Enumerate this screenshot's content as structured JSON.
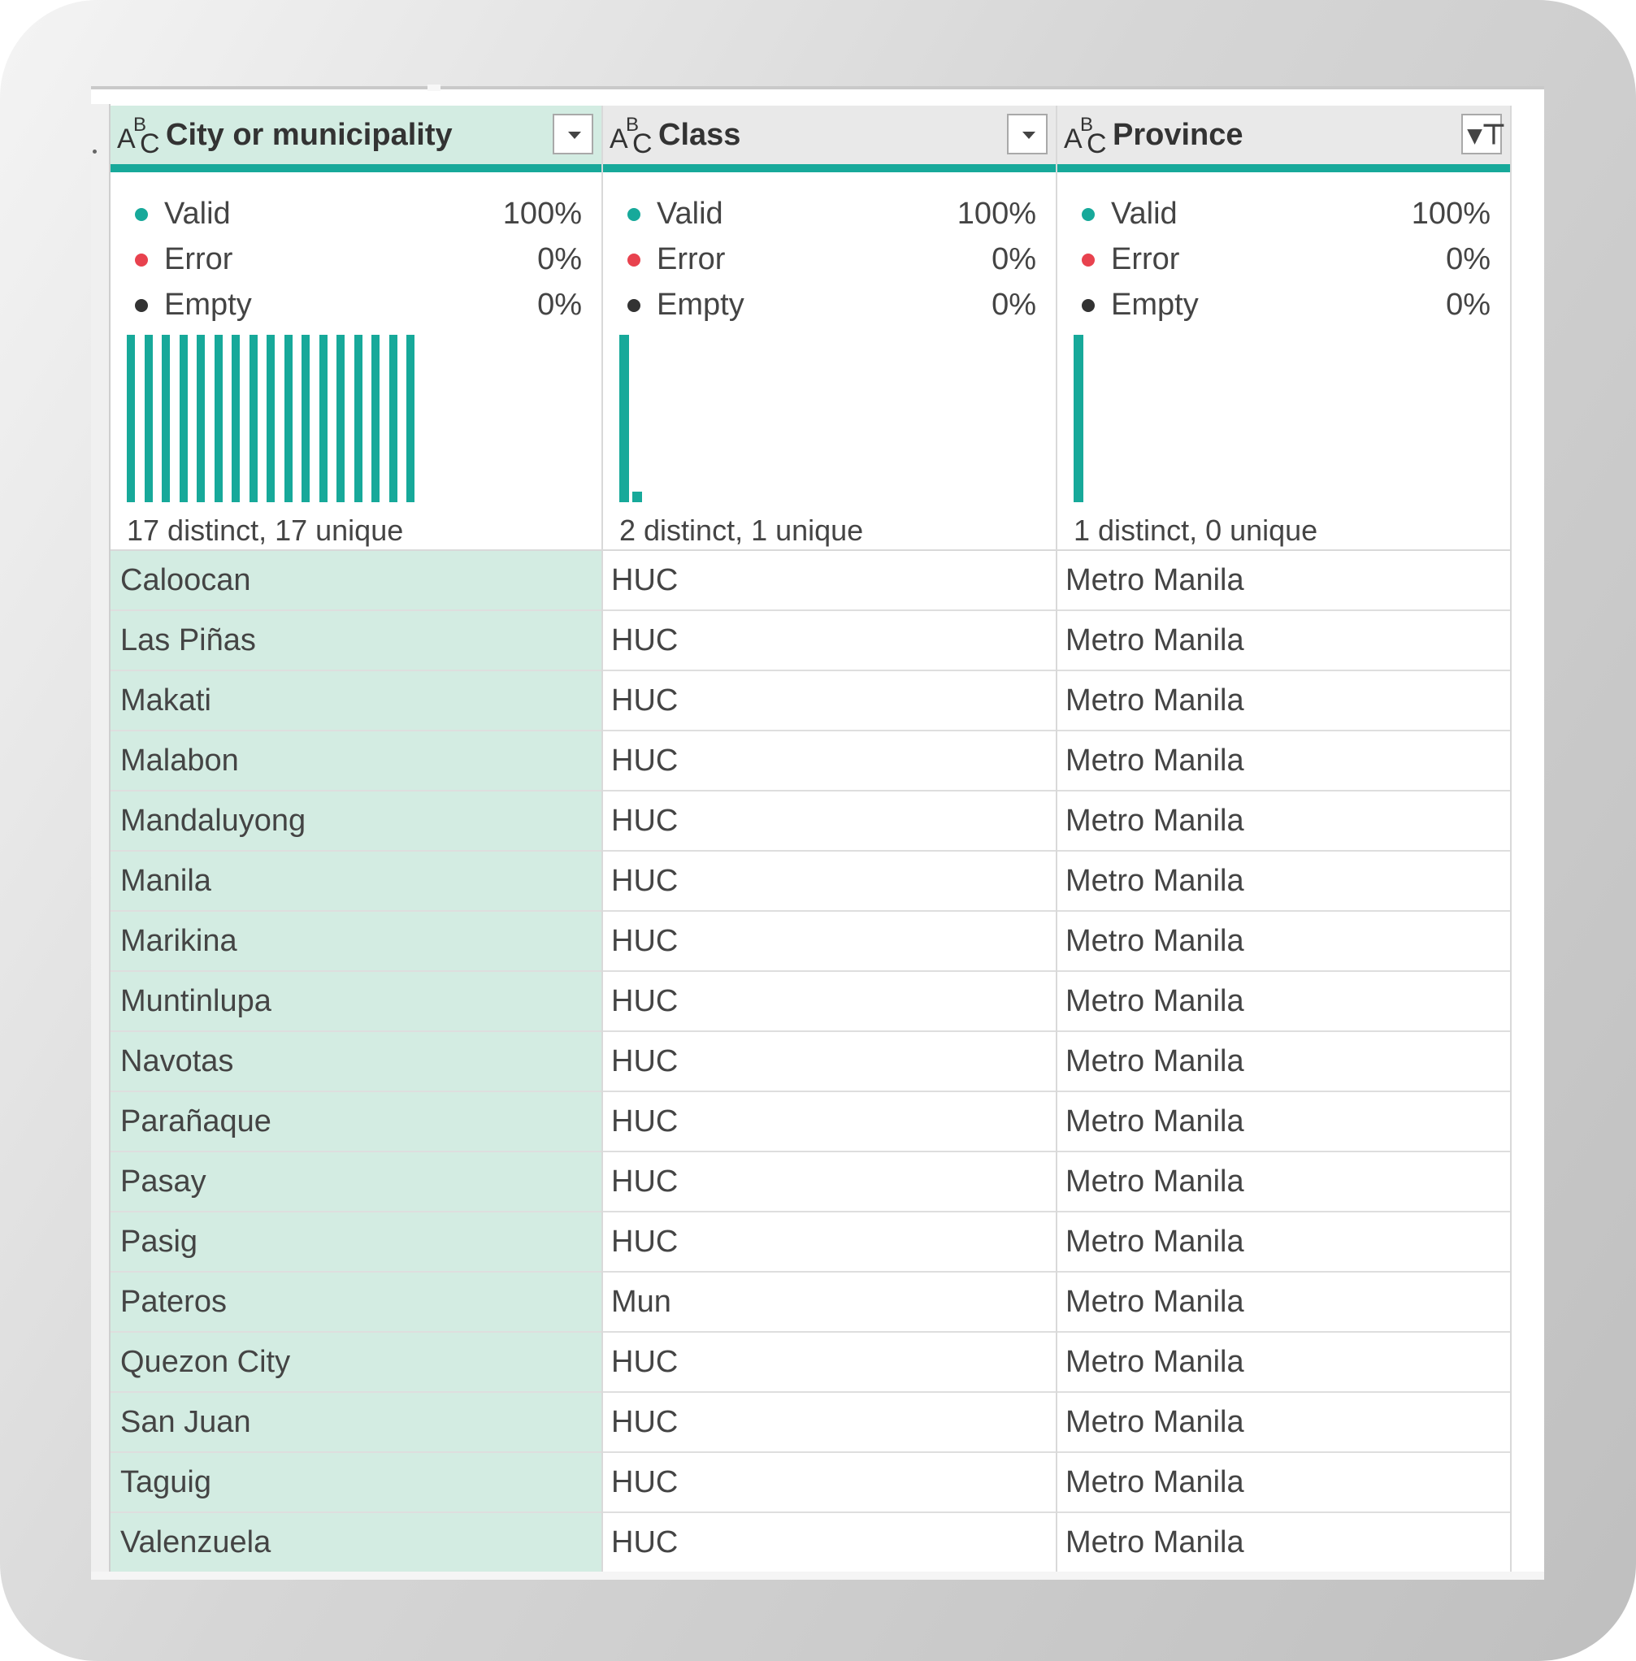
{
  "columns": [
    {
      "title": "City or municipality",
      "type_icon": "abc-text-icon",
      "header_button": "dropdown",
      "stats": {
        "valid": "Valid",
        "valid_pct": "100%",
        "error": "Error",
        "error_pct": "0%",
        "empty": "Empty",
        "empty_pct": "0%"
      },
      "distribution": [
        1,
        1,
        1,
        1,
        1,
        1,
        1,
        1,
        1,
        1,
        1,
        1,
        1,
        1,
        1,
        1,
        1
      ],
      "distinct_text": "17 distinct, 17 unique"
    },
    {
      "title": "Class",
      "type_icon": "abc-text-icon",
      "header_button": "dropdown",
      "stats": {
        "valid": "Valid",
        "valid_pct": "100%",
        "error": "Error",
        "error_pct": "0%",
        "empty": "Empty",
        "empty_pct": "0%"
      },
      "distribution": [
        16,
        1
      ],
      "distinct_text": "2 distinct, 1 unique"
    },
    {
      "title": "Province",
      "type_icon": "abc-text-icon",
      "header_button": "filter-active",
      "stats": {
        "valid": "Valid",
        "valid_pct": "100%",
        "error": "Error",
        "error_pct": "0%",
        "empty": "Empty",
        "empty_pct": "0%"
      },
      "distribution": [
        17
      ],
      "distinct_text": "1 distinct, 0 unique"
    }
  ],
  "rows": [
    [
      "Caloocan",
      "HUC",
      "Metro Manila"
    ],
    [
      "Las Piñas",
      "HUC",
      "Metro Manila"
    ],
    [
      "Makati",
      "HUC",
      "Metro Manila"
    ],
    [
      "Malabon",
      "HUC",
      "Metro Manila"
    ],
    [
      "Mandaluyong",
      "HUC",
      "Metro Manila"
    ],
    [
      "Manila",
      "HUC",
      "Metro Manila"
    ],
    [
      "Marikina",
      "HUC",
      "Metro Manila"
    ],
    [
      "Muntinlupa",
      "HUC",
      "Metro Manila"
    ],
    [
      "Navotas",
      "HUC",
      "Metro Manila"
    ],
    [
      "Parañaque",
      "HUC",
      "Metro Manila"
    ],
    [
      "Pasay",
      "HUC",
      "Metro Manila"
    ],
    [
      "Pasig",
      "HUC",
      "Metro Manila"
    ],
    [
      "Pateros",
      "Mun",
      "Metro Manila"
    ],
    [
      "Quezon City",
      "HUC",
      "Metro Manila"
    ],
    [
      "San Juan",
      "HUC",
      "Metro Manila"
    ],
    [
      "Taguig",
      "HUC",
      "Metro Manila"
    ],
    [
      "Valenzuela",
      "HUC",
      "Metro Manila"
    ]
  ],
  "colors": {
    "accent": "#17a99a",
    "selected_column_bg": "#d3ece2",
    "valid": "#17a99a",
    "error": "#e8424e",
    "empty": "#333333"
  }
}
